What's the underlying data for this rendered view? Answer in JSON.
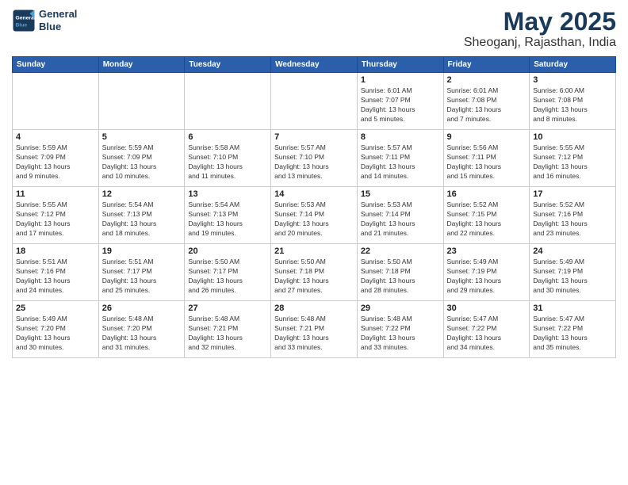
{
  "logo": {
    "line1": "General",
    "line2": "Blue"
  },
  "title": "May 2025",
  "subtitle": "Sheoganj, Rajasthan, India",
  "weekdays": [
    "Sunday",
    "Monday",
    "Tuesday",
    "Wednesday",
    "Thursday",
    "Friday",
    "Saturday"
  ],
  "weeks": [
    [
      {
        "day": "",
        "info": ""
      },
      {
        "day": "",
        "info": ""
      },
      {
        "day": "",
        "info": ""
      },
      {
        "day": "",
        "info": ""
      },
      {
        "day": "1",
        "info": "Sunrise: 6:01 AM\nSunset: 7:07 PM\nDaylight: 13 hours\nand 5 minutes."
      },
      {
        "day": "2",
        "info": "Sunrise: 6:01 AM\nSunset: 7:08 PM\nDaylight: 13 hours\nand 7 minutes."
      },
      {
        "day": "3",
        "info": "Sunrise: 6:00 AM\nSunset: 7:08 PM\nDaylight: 13 hours\nand 8 minutes."
      }
    ],
    [
      {
        "day": "4",
        "info": "Sunrise: 5:59 AM\nSunset: 7:09 PM\nDaylight: 13 hours\nand 9 minutes."
      },
      {
        "day": "5",
        "info": "Sunrise: 5:59 AM\nSunset: 7:09 PM\nDaylight: 13 hours\nand 10 minutes."
      },
      {
        "day": "6",
        "info": "Sunrise: 5:58 AM\nSunset: 7:10 PM\nDaylight: 13 hours\nand 11 minutes."
      },
      {
        "day": "7",
        "info": "Sunrise: 5:57 AM\nSunset: 7:10 PM\nDaylight: 13 hours\nand 13 minutes."
      },
      {
        "day": "8",
        "info": "Sunrise: 5:57 AM\nSunset: 7:11 PM\nDaylight: 13 hours\nand 14 minutes."
      },
      {
        "day": "9",
        "info": "Sunrise: 5:56 AM\nSunset: 7:11 PM\nDaylight: 13 hours\nand 15 minutes."
      },
      {
        "day": "10",
        "info": "Sunrise: 5:55 AM\nSunset: 7:12 PM\nDaylight: 13 hours\nand 16 minutes."
      }
    ],
    [
      {
        "day": "11",
        "info": "Sunrise: 5:55 AM\nSunset: 7:12 PM\nDaylight: 13 hours\nand 17 minutes."
      },
      {
        "day": "12",
        "info": "Sunrise: 5:54 AM\nSunset: 7:13 PM\nDaylight: 13 hours\nand 18 minutes."
      },
      {
        "day": "13",
        "info": "Sunrise: 5:54 AM\nSunset: 7:13 PM\nDaylight: 13 hours\nand 19 minutes."
      },
      {
        "day": "14",
        "info": "Sunrise: 5:53 AM\nSunset: 7:14 PM\nDaylight: 13 hours\nand 20 minutes."
      },
      {
        "day": "15",
        "info": "Sunrise: 5:53 AM\nSunset: 7:14 PM\nDaylight: 13 hours\nand 21 minutes."
      },
      {
        "day": "16",
        "info": "Sunrise: 5:52 AM\nSunset: 7:15 PM\nDaylight: 13 hours\nand 22 minutes."
      },
      {
        "day": "17",
        "info": "Sunrise: 5:52 AM\nSunset: 7:16 PM\nDaylight: 13 hours\nand 23 minutes."
      }
    ],
    [
      {
        "day": "18",
        "info": "Sunrise: 5:51 AM\nSunset: 7:16 PM\nDaylight: 13 hours\nand 24 minutes."
      },
      {
        "day": "19",
        "info": "Sunrise: 5:51 AM\nSunset: 7:17 PM\nDaylight: 13 hours\nand 25 minutes."
      },
      {
        "day": "20",
        "info": "Sunrise: 5:50 AM\nSunset: 7:17 PM\nDaylight: 13 hours\nand 26 minutes."
      },
      {
        "day": "21",
        "info": "Sunrise: 5:50 AM\nSunset: 7:18 PM\nDaylight: 13 hours\nand 27 minutes."
      },
      {
        "day": "22",
        "info": "Sunrise: 5:50 AM\nSunset: 7:18 PM\nDaylight: 13 hours\nand 28 minutes."
      },
      {
        "day": "23",
        "info": "Sunrise: 5:49 AM\nSunset: 7:19 PM\nDaylight: 13 hours\nand 29 minutes."
      },
      {
        "day": "24",
        "info": "Sunrise: 5:49 AM\nSunset: 7:19 PM\nDaylight: 13 hours\nand 30 minutes."
      }
    ],
    [
      {
        "day": "25",
        "info": "Sunrise: 5:49 AM\nSunset: 7:20 PM\nDaylight: 13 hours\nand 30 minutes."
      },
      {
        "day": "26",
        "info": "Sunrise: 5:48 AM\nSunset: 7:20 PM\nDaylight: 13 hours\nand 31 minutes."
      },
      {
        "day": "27",
        "info": "Sunrise: 5:48 AM\nSunset: 7:21 PM\nDaylight: 13 hours\nand 32 minutes."
      },
      {
        "day": "28",
        "info": "Sunrise: 5:48 AM\nSunset: 7:21 PM\nDaylight: 13 hours\nand 33 minutes."
      },
      {
        "day": "29",
        "info": "Sunrise: 5:48 AM\nSunset: 7:22 PM\nDaylight: 13 hours\nand 33 minutes."
      },
      {
        "day": "30",
        "info": "Sunrise: 5:47 AM\nSunset: 7:22 PM\nDaylight: 13 hours\nand 34 minutes."
      },
      {
        "day": "31",
        "info": "Sunrise: 5:47 AM\nSunset: 7:22 PM\nDaylight: 13 hours\nand 35 minutes."
      }
    ]
  ]
}
